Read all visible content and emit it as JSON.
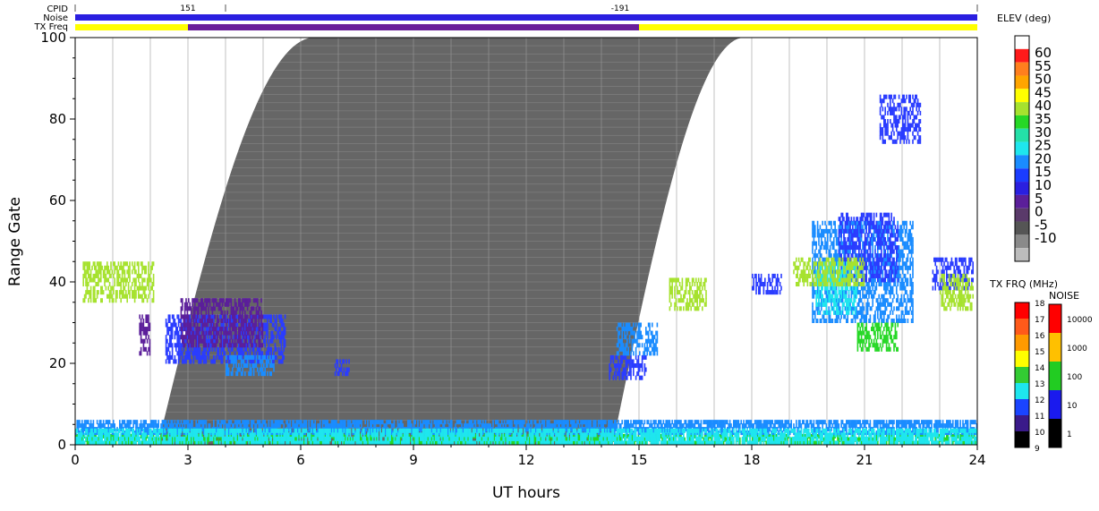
{
  "header": {
    "cpid_label": "CPID",
    "noise_label": "Noise",
    "txfreq_label": "TX Freq",
    "cpid_values": [
      {
        "x": 3.0,
        "text": "151"
      },
      {
        "x": 14.5,
        "text": "-191"
      }
    ],
    "cpid_markers": [
      0,
      4.0,
      24
    ],
    "noise_color": "#2a1fe0",
    "txfreq_segments": [
      {
        "start": 0,
        "end": 3.0,
        "color": "#ffff00"
      },
      {
        "start": 3.0,
        "end": 15.0,
        "color": "#6a1f9a"
      },
      {
        "start": 15.0,
        "end": 24,
        "color": "#ffff00"
      }
    ]
  },
  "chart_data": {
    "type": "heatmap",
    "title": "",
    "xlabel": "UT hours",
    "ylabel": "Range Gate",
    "xlim": [
      0,
      24
    ],
    "ylim": [
      0,
      100
    ],
    "x_ticks": [
      "0",
      "3",
      "6",
      "9",
      "12",
      "15",
      "18",
      "21",
      "24"
    ],
    "x_tick_values": [
      0,
      3,
      6,
      9,
      12,
      15,
      18,
      21,
      24
    ],
    "y_ticks": [
      "0",
      "20",
      "40",
      "60",
      "80",
      "100"
    ],
    "y_tick_values": [
      0,
      20,
      40,
      60,
      80,
      100
    ],
    "hour_gridlines": true,
    "ground_scatter": {
      "color": "#666666",
      "rise_start_hour": 2.2,
      "full_hour": 6.3,
      "set_begin_hour": 14.3,
      "set_end_hour": 17.8
    },
    "elevation_scale": {
      "label": "ELEV (deg)",
      "ticks": [
        "60",
        "55",
        "50",
        "45",
        "40",
        "35",
        "30",
        "25",
        "20",
        "15",
        "10",
        "5",
        "0",
        "-5",
        "-10"
      ],
      "colors": [
        "#ffffff",
        "#ff1a1a",
        "#ff7f1e",
        "#ffa500",
        "#ffff00",
        "#a6e22e",
        "#26d826",
        "#24e0a8",
        "#1ee6ee",
        "#1a8cff",
        "#1a3cff",
        "#2a1fe0",
        "#5b1f9a",
        "#5a3a6a",
        "#555555",
        "#8a8a8a",
        "#bcbcbc"
      ]
    },
    "txfreq_scale": {
      "label": "TX FRQ (MHz)",
      "ticks": [
        "18",
        "17",
        "16",
        "15",
        "14",
        "13",
        "12",
        "11",
        "10",
        "9"
      ],
      "colors": [
        "#ff0000",
        "#ff5a1a",
        "#ff9a00",
        "#ffff00",
        "#33cc33",
        "#1ee6ee",
        "#1a44ff",
        "#3a1a8a",
        "#000000"
      ]
    },
    "noise_scale": {
      "label": "NOISE",
      "ticks": [
        "10000",
        "1000",
        "100",
        "10",
        "1"
      ],
      "colors": [
        "#ff0000",
        "#ffc000",
        "#22cc22",
        "#1a1aee",
        "#000000"
      ]
    },
    "echo_regions": [
      {
        "t0": 2.4,
        "t1": 5.6,
        "r0": 20,
        "r1": 32,
        "color": "#2a3cff"
      },
      {
        "t0": 2.8,
        "t1": 5.0,
        "r0": 24,
        "r1": 36,
        "color": "#5b1f9a"
      },
      {
        "t0": 4.0,
        "t1": 5.3,
        "r0": 17,
        "r1": 22,
        "color": "#1a8cff"
      },
      {
        "t0": 1.7,
        "t1": 2.0,
        "r0": 22,
        "r1": 32,
        "color": "#5b1f9a"
      },
      {
        "t0": 6.9,
        "t1": 7.3,
        "r0": 17,
        "r1": 21,
        "color": "#2a3cff"
      },
      {
        "t0": 14.2,
        "t1": 15.2,
        "r0": 16,
        "r1": 22,
        "color": "#2a3cff"
      },
      {
        "t0": 14.4,
        "t1": 15.5,
        "r0": 22,
        "r1": 30,
        "color": "#1a8cff"
      },
      {
        "t0": 0.2,
        "t1": 2.1,
        "r0": 35,
        "r1": 45,
        "color": "#a6e22e"
      },
      {
        "t0": 15.8,
        "t1": 16.8,
        "r0": 33,
        "r1": 41,
        "color": "#a6e22e"
      },
      {
        "t0": 18.0,
        "t1": 18.8,
        "r0": 37,
        "r1": 42,
        "color": "#2a3cff"
      },
      {
        "t0": 19.6,
        "t1": 22.3,
        "r0": 30,
        "r1": 55,
        "color": "#1a8cff"
      },
      {
        "t0": 20.3,
        "t1": 21.9,
        "r0": 40,
        "r1": 57,
        "color": "#2a3cff"
      },
      {
        "t0": 19.7,
        "t1": 20.8,
        "r0": 32,
        "r1": 45,
        "color": "#1ee6ee"
      },
      {
        "t0": 20.8,
        "t1": 21.9,
        "r0": 23,
        "r1": 30,
        "color": "#26d826"
      },
      {
        "t0": 22.8,
        "t1": 23.9,
        "r0": 38,
        "r1": 46,
        "color": "#2a3cff"
      },
      {
        "t0": 23.0,
        "t1": 23.9,
        "r0": 33,
        "r1": 42,
        "color": "#a6e22e"
      },
      {
        "t0": 21.4,
        "t1": 22.5,
        "r0": 74,
        "r1": 86,
        "color": "#2a3cff"
      },
      {
        "t0": 19.1,
        "t1": 21.0,
        "r0": 39,
        "r1": 46,
        "color": "#a6e22e"
      },
      {
        "t0": 0,
        "t1": 24,
        "r0": 0,
        "r1": 2.5,
        "color": "#26d826"
      },
      {
        "t0": 0,
        "t1": 24,
        "r0": 2.5,
        "r1": 6,
        "color": "#1a8cff"
      },
      {
        "t0": 0,
        "t1": 24,
        "r0": 0,
        "r1": 4,
        "color": "#1ee6ee"
      }
    ]
  }
}
